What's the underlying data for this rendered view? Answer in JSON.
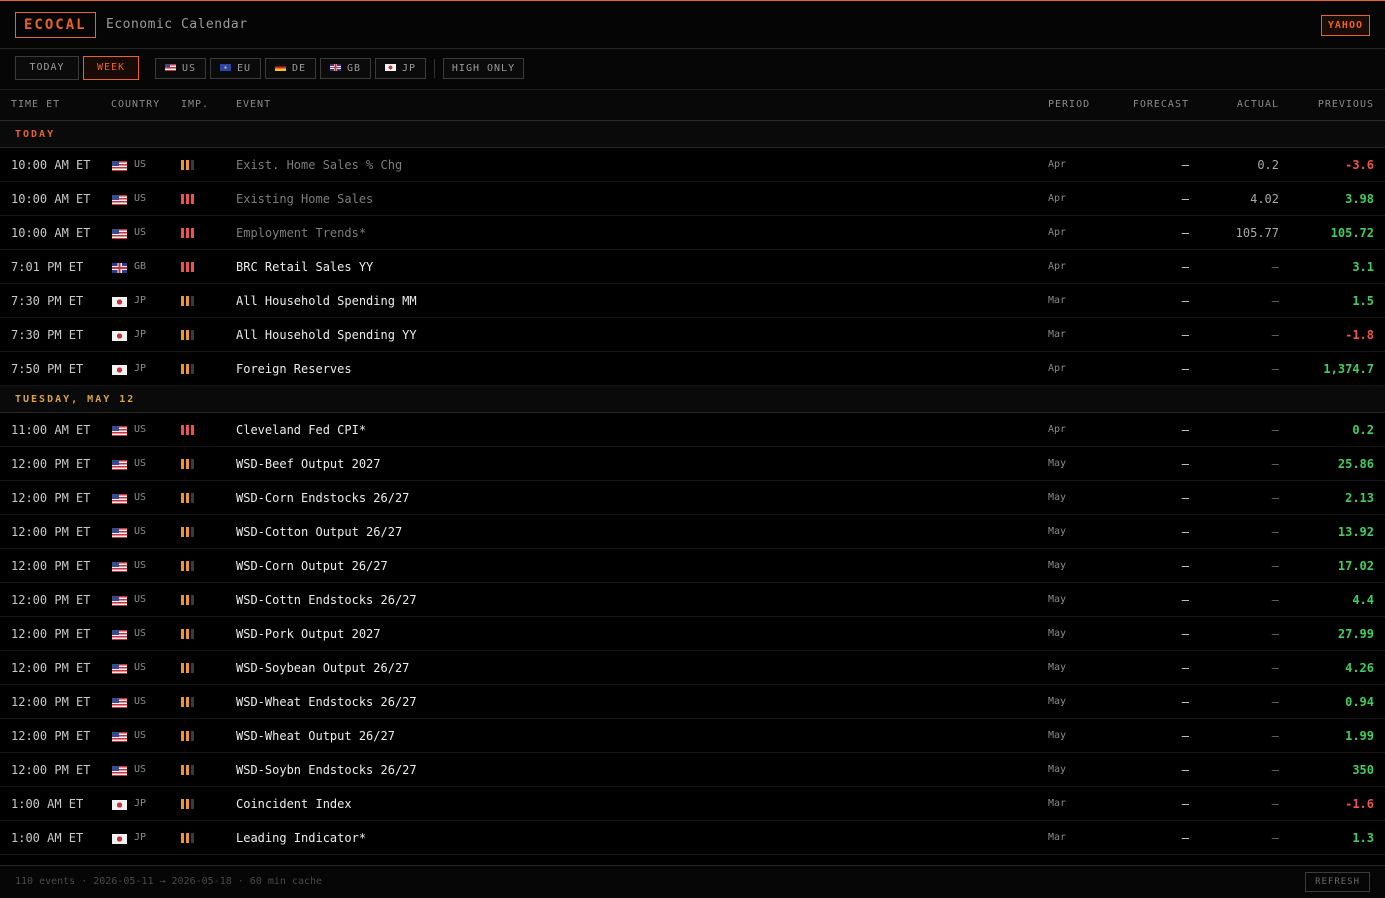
{
  "header": {
    "logo": "ECOCAL",
    "title": "Economic Calendar",
    "source": "YAHOO"
  },
  "filters": {
    "today": "TODAY",
    "week": "WEEK",
    "countries": [
      {
        "code": "US",
        "flag": "us"
      },
      {
        "code": "EU",
        "flag": "eu"
      },
      {
        "code": "DE",
        "flag": "de"
      },
      {
        "code": "GB",
        "flag": "gb"
      },
      {
        "code": "JP",
        "flag": "jp"
      }
    ],
    "high_only": "HIGH ONLY"
  },
  "columns": {
    "time": "TIME ET",
    "country": "COUNTRY",
    "importance": "IMP.",
    "event": "EVENT",
    "period": "PERIOD",
    "forecast": "FORECAST",
    "actual": "ACTUAL",
    "previous": "PREVIOUS"
  },
  "colors": {
    "accent": "#e8622b",
    "today_header": "#e8622b",
    "day_header": "#d9a441",
    "positive": "#3fcf5a",
    "negative": "#f05050",
    "imp_high": "#f05050",
    "imp_medium": "#f0962a",
    "imp_off": "#3a3a3a"
  },
  "sections": [
    {
      "label": "TODAY",
      "kind": "today",
      "rows": [
        {
          "time": "10:00 AM ET",
          "flag": "us",
          "country": "US",
          "imp": 2,
          "event": "Exist. Home Sales % Chg",
          "past": true,
          "period": "Apr",
          "forecast": "—",
          "actual": "0.2",
          "previous": "-3.6",
          "dir": "neg"
        },
        {
          "time": "10:00 AM ET",
          "flag": "us",
          "country": "US",
          "imp": 3,
          "event": "Existing Home Sales",
          "past": true,
          "period": "Apr",
          "forecast": "—",
          "actual": "4.02",
          "previous": "3.98",
          "dir": "pos"
        },
        {
          "time": "10:00 AM ET",
          "flag": "us",
          "country": "US",
          "imp": 3,
          "event": "Employment Trends*",
          "past": true,
          "period": "Apr",
          "forecast": "—",
          "actual": "105.77",
          "previous": "105.72",
          "dir": "pos"
        },
        {
          "time": "7:01 PM ET",
          "flag": "gb",
          "country": "GB",
          "imp": 3,
          "event": "BRC Retail Sales YY",
          "past": false,
          "period": "Apr",
          "forecast": "—",
          "actual": "—",
          "previous": "3.1",
          "dir": "pos"
        },
        {
          "time": "7:30 PM ET",
          "flag": "jp",
          "country": "JP",
          "imp": 2,
          "event": "All Household Spending MM",
          "past": false,
          "period": "Mar",
          "forecast": "—",
          "actual": "—",
          "previous": "1.5",
          "dir": "pos"
        },
        {
          "time": "7:30 PM ET",
          "flag": "jp",
          "country": "JP",
          "imp": 2,
          "event": "All Household Spending YY",
          "past": false,
          "period": "Mar",
          "forecast": "—",
          "actual": "—",
          "previous": "-1.8",
          "dir": "neg"
        },
        {
          "time": "7:50 PM ET",
          "flag": "jp",
          "country": "JP",
          "imp": 2,
          "event": "Foreign Reserves",
          "past": false,
          "period": "Apr",
          "forecast": "—",
          "actual": "—",
          "previous": "1,374.7",
          "dir": "pos"
        }
      ]
    },
    {
      "label": "TUESDAY, MAY 12",
      "kind": "day",
      "rows": [
        {
          "time": "11:00 AM ET",
          "flag": "us",
          "country": "US",
          "imp": 3,
          "event": "Cleveland Fed CPI*",
          "past": false,
          "period": "Apr",
          "forecast": "—",
          "actual": "—",
          "previous": "0.2",
          "dir": "pos"
        },
        {
          "time": "12:00 PM ET",
          "flag": "us",
          "country": "US",
          "imp": 2,
          "event": "WSD-Beef Output 2027",
          "past": false,
          "period": "May",
          "forecast": "—",
          "actual": "—",
          "previous": "25.86",
          "dir": "pos"
        },
        {
          "time": "12:00 PM ET",
          "flag": "us",
          "country": "US",
          "imp": 2,
          "event": "WSD-Corn Endstocks 26/27",
          "past": false,
          "period": "May",
          "forecast": "—",
          "actual": "—",
          "previous": "2.13",
          "dir": "pos"
        },
        {
          "time": "12:00 PM ET",
          "flag": "us",
          "country": "US",
          "imp": 2,
          "event": "WSD-Cotton Output 26/27",
          "past": false,
          "period": "May",
          "forecast": "—",
          "actual": "—",
          "previous": "13.92",
          "dir": "pos"
        },
        {
          "time": "12:00 PM ET",
          "flag": "us",
          "country": "US",
          "imp": 2,
          "event": "WSD-Corn Output 26/27",
          "past": false,
          "period": "May",
          "forecast": "—",
          "actual": "—",
          "previous": "17.02",
          "dir": "pos"
        },
        {
          "time": "12:00 PM ET",
          "flag": "us",
          "country": "US",
          "imp": 2,
          "event": "WSD-Cottn Endstocks 26/27",
          "past": false,
          "period": "May",
          "forecast": "—",
          "actual": "—",
          "previous": "4.4",
          "dir": "pos"
        },
        {
          "time": "12:00 PM ET",
          "flag": "us",
          "country": "US",
          "imp": 2,
          "event": "WSD-Pork Output 2027",
          "past": false,
          "period": "May",
          "forecast": "—",
          "actual": "—",
          "previous": "27.99",
          "dir": "pos"
        },
        {
          "time": "12:00 PM ET",
          "flag": "us",
          "country": "US",
          "imp": 2,
          "event": "WSD-Soybean Output 26/27",
          "past": false,
          "period": "May",
          "forecast": "—",
          "actual": "—",
          "previous": "4.26",
          "dir": "pos"
        },
        {
          "time": "12:00 PM ET",
          "flag": "us",
          "country": "US",
          "imp": 2,
          "event": "WSD-Wheat Endstocks 26/27",
          "past": false,
          "period": "May",
          "forecast": "—",
          "actual": "—",
          "previous": "0.94",
          "dir": "pos"
        },
        {
          "time": "12:00 PM ET",
          "flag": "us",
          "country": "US",
          "imp": 2,
          "event": "WSD-Wheat Output 26/27",
          "past": false,
          "period": "May",
          "forecast": "—",
          "actual": "—",
          "previous": "1.99",
          "dir": "pos"
        },
        {
          "time": "12:00 PM ET",
          "flag": "us",
          "country": "US",
          "imp": 2,
          "event": "WSD-Soybn Endstocks 26/27",
          "past": false,
          "period": "May",
          "forecast": "—",
          "actual": "—",
          "previous": "350",
          "dir": "pos"
        },
        {
          "time": "1:00 AM ET",
          "flag": "jp",
          "country": "JP",
          "imp": 2,
          "event": "Coincident Index",
          "past": false,
          "period": "Mar",
          "forecast": "—",
          "actual": "—",
          "previous": "-1.6",
          "dir": "neg"
        },
        {
          "time": "1:00 AM ET",
          "flag": "jp",
          "country": "JP",
          "imp": 2,
          "event": "Leading Indicator*",
          "past": false,
          "period": "Mar",
          "forecast": "—",
          "actual": "—",
          "previous": "1.3",
          "dir": "pos"
        }
      ]
    }
  ],
  "footer": {
    "summary": "110 events · 2026-05-11 → 2026-05-18 · 60 min cache",
    "refresh": "REFRESH"
  }
}
